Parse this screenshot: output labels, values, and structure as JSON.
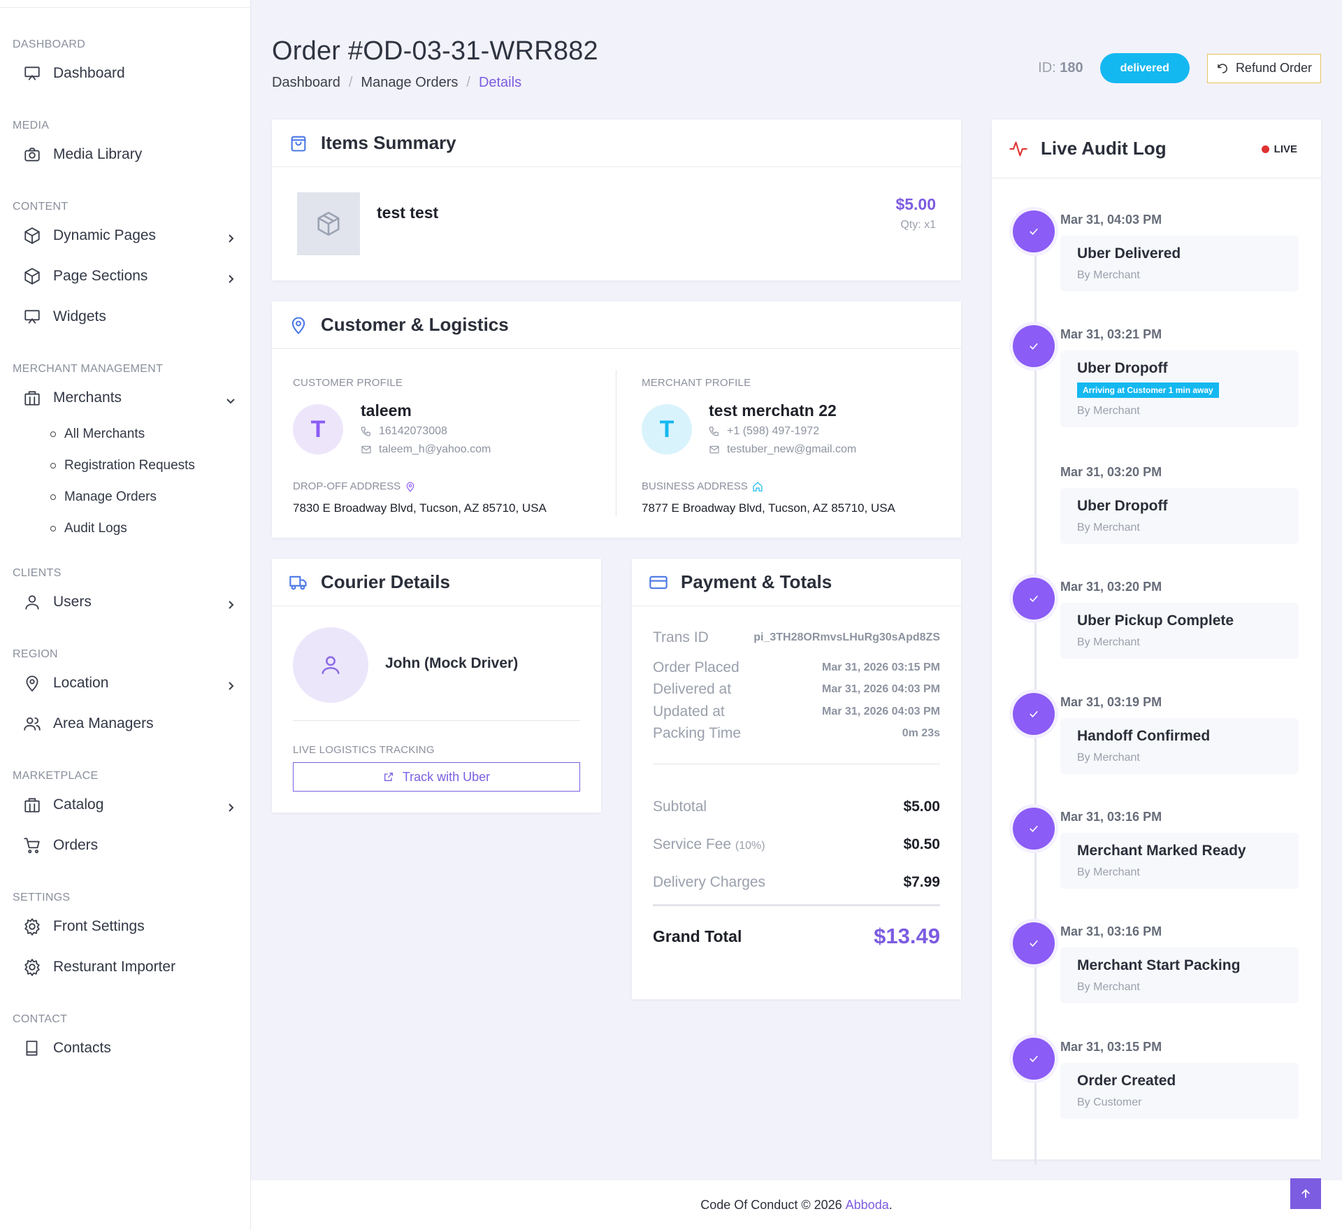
{
  "sidebar": {
    "sections": {
      "dashboard": "DASHBOARD",
      "media": "MEDIA",
      "content": "CONTENT",
      "merchant": "MERCHANT MANAGEMENT",
      "clients": "CLIENTS",
      "region": "REGION",
      "marketplace": "MARKETPLACE",
      "settings": "SETTINGS",
      "contact": "CONTACT"
    },
    "items": {
      "dashboard": "Dashboard",
      "media_library": "Media Library",
      "dynamic_pages": "Dynamic Pages",
      "page_sections": "Page Sections",
      "widgets": "Widgets",
      "merchants": "Merchants",
      "all_merchants": "All Merchants",
      "registration_requests": "Registration Requests",
      "manage_orders": "Manage Orders",
      "audit_logs": "Audit Logs",
      "users": "Users",
      "location": "Location",
      "area_managers": "Area Managers",
      "catalog": "Catalog",
      "orders": "Orders",
      "front_settings": "Front Settings",
      "resturant_importer": "Resturant Importer",
      "contacts": "Contacts"
    }
  },
  "header": {
    "title": "Order #OD-03-31-WRR882",
    "breadcrumb": [
      "Dashboard",
      "Manage Orders",
      "Details"
    ],
    "breadcrumb_sep": "/",
    "id_label": "ID:",
    "id_value": "180",
    "status": "delivered",
    "refund_label": "Refund Order"
  },
  "items_summary": {
    "title": "Items Summary",
    "item": {
      "name": "test test",
      "price": "$5.00",
      "qty": "Qty: x1"
    }
  },
  "customer_logistics": {
    "title": "Customer & Logistics",
    "customer": {
      "caption": "CUSTOMER PROFILE",
      "initial": "T",
      "name": "taleem",
      "phone": "16142073008",
      "email": "taleem_h@yahoo.com",
      "address_caption": "DROP-OFF ADDRESS",
      "address": "7830 E Broadway Blvd, Tucson, AZ 85710, USA"
    },
    "merchant": {
      "caption": "MERCHANT PROFILE",
      "initial": "T",
      "name": "test merchatn 22",
      "phone": "+1 (598) 497-1972",
      "email": "testuber_new@gmail.com",
      "address_caption": "BUSINESS ADDRESS",
      "address": "7877 E Broadway Blvd, Tucson, AZ 85710, USA"
    }
  },
  "courier": {
    "title": "Courier Details",
    "driver": "John (Mock Driver)",
    "tracking_caption": "LIVE LOGISTICS TRACKING",
    "track_button": "Track with Uber"
  },
  "payment": {
    "title": "Payment & Totals",
    "rows": [
      {
        "label": "Trans ID",
        "value": "pi_3TH28ORmvsLHuRg30sApd8ZS"
      },
      {
        "label": "Order Placed",
        "value": "Mar 31, 2026 03:15 PM"
      },
      {
        "label": "Delivered at",
        "value": "Mar 31, 2026 04:03 PM"
      },
      {
        "label": "Updated at",
        "value": "Mar 31, 2026 04:03 PM"
      },
      {
        "label": "Packing Time",
        "value": "0m 23s"
      }
    ],
    "subtotal_label": "Subtotal",
    "subtotal": "$5.00",
    "service_fee_label": "Service Fee",
    "service_fee_pct": "(10%)",
    "service_fee": "$0.50",
    "delivery_label": "Delivery Charges",
    "delivery": "$7.99",
    "grand_label": "Grand Total",
    "grand": "$13.49"
  },
  "audit": {
    "title": "Live Audit Log",
    "live": "LIVE",
    "events": [
      {
        "time": "Mar 31, 04:03 PM",
        "title": "Uber Delivered",
        "by": "By Merchant",
        "tag": ""
      },
      {
        "time": "Mar 31, 03:21 PM",
        "title": "Uber Dropoff",
        "by": "By Merchant",
        "tag": "Arriving at Customer 1 min away"
      },
      {
        "time": "Mar 31, 03:20 PM",
        "title": "Uber Dropoff",
        "by": "By Merchant",
        "tag": ""
      },
      {
        "time": "Mar 31, 03:20 PM",
        "title": "Uber Pickup Complete",
        "by": "By Merchant",
        "tag": ""
      },
      {
        "time": "Mar 31, 03:19 PM",
        "title": "Handoff Confirmed",
        "by": "By Merchant",
        "tag": ""
      },
      {
        "time": "Mar 31, 03:16 PM",
        "title": "Merchant Marked Ready",
        "by": "By Merchant",
        "tag": ""
      },
      {
        "time": "Mar 31, 03:16 PM",
        "title": "Merchant Start Packing",
        "by": "By Merchant",
        "tag": ""
      },
      {
        "time": "Mar 31, 03:15 PM",
        "title": "Order Created",
        "by": "By Customer",
        "tag": ""
      }
    ]
  },
  "footer": {
    "text": "Code Of Conduct © 2026",
    "brand": "Abboda",
    "end": "."
  }
}
